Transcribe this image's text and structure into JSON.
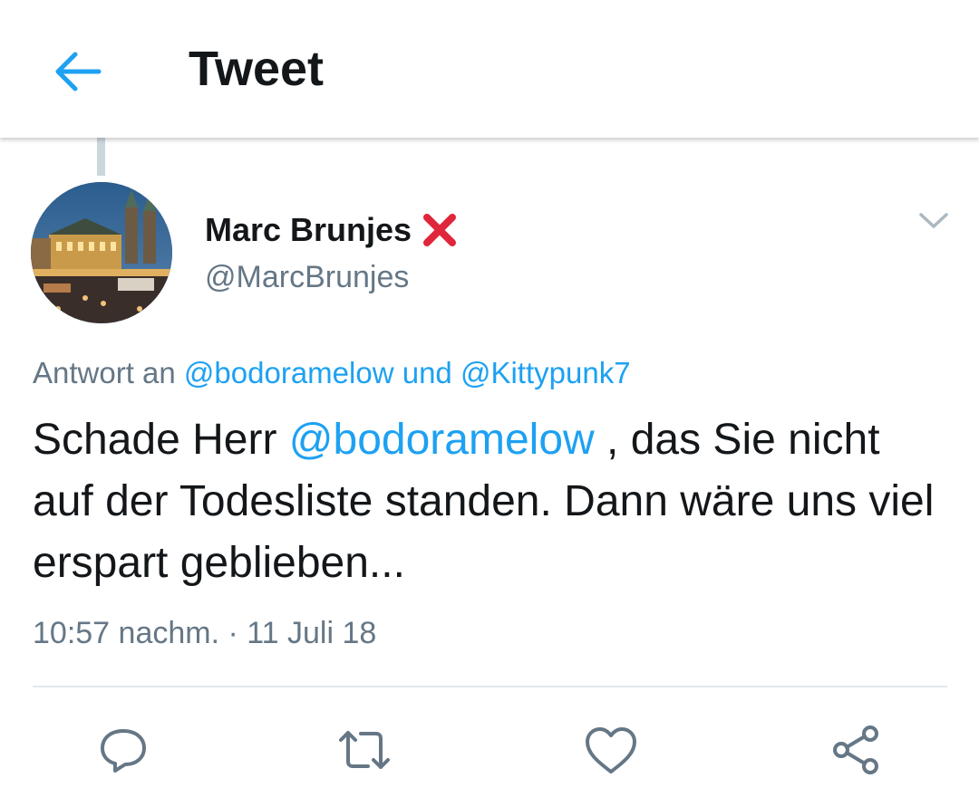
{
  "header": {
    "title": "Tweet",
    "back_icon": "arrow-left-icon"
  },
  "colors": {
    "accent": "#1da1f2",
    "text": "#14171a",
    "secondary": "#657786",
    "divider": "#e1e8ed"
  },
  "tweet": {
    "author_name": "Marc Brunjes",
    "author_badge_icon": "red-cross-mark-icon",
    "author_handle": "@MarcBrunjes",
    "reply_to_prefix": "Antwort an",
    "reply_to_user_1": "@bodoramelow",
    "reply_to_join": "und",
    "reply_to_user_2": "@Kittypunk7",
    "text_before_mention": "Schade Herr ",
    "text_mention": "@bodoramelow",
    "text_after_mention": " , das Sie nicht auf der Todesliste standen. Dann wäre uns viel erspart geblieben...",
    "time": "10:57 nachm.",
    "separator": "·",
    "date": "11 Juli 18"
  },
  "actions": [
    {
      "icon": "reply-icon"
    },
    {
      "icon": "retweet-icon"
    },
    {
      "icon": "like-icon"
    },
    {
      "icon": "share-icon"
    }
  ]
}
